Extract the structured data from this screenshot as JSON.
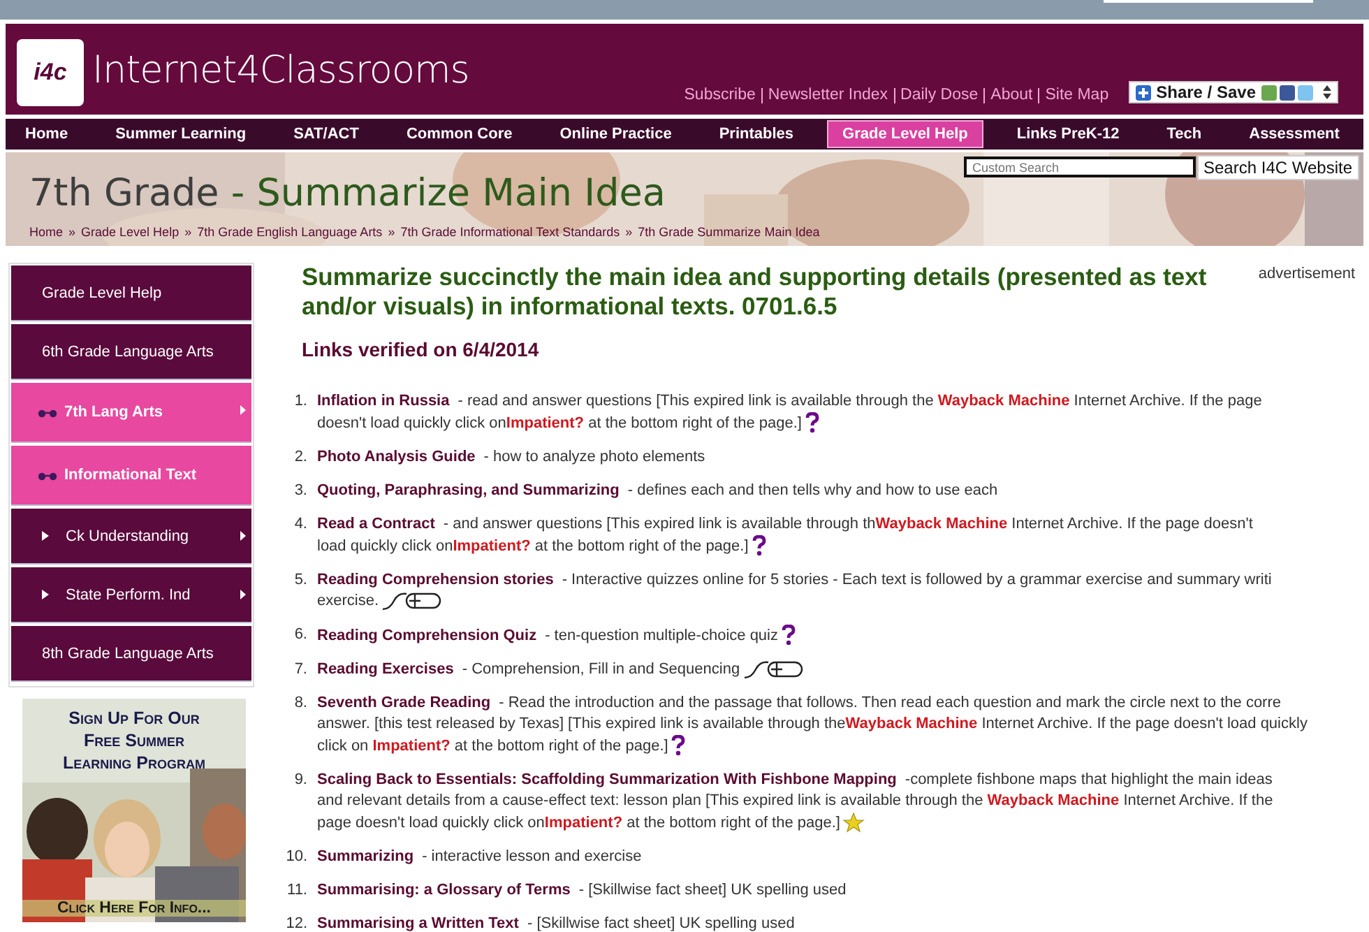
{
  "header": {
    "logo_text": "i4c",
    "site_name": "Internet4Classrooms",
    "links": [
      "Subscribe",
      "Newsletter Index",
      "Daily Dose",
      "About",
      "Site Map"
    ],
    "share_button": "Share / Save"
  },
  "nav": [
    {
      "label": "Home",
      "selected": false
    },
    {
      "label": "Summer Learning",
      "selected": false
    },
    {
      "label": "SAT/ACT",
      "selected": false
    },
    {
      "label": "Common Core",
      "selected": false
    },
    {
      "label": "Online Practice",
      "selected": false
    },
    {
      "label": "Printables",
      "selected": false
    },
    {
      "label": "Grade Level Help",
      "selected": true
    },
    {
      "label": "Links PreK-12",
      "selected": false
    },
    {
      "label": "Tech",
      "selected": false
    },
    {
      "label": "Assessment",
      "selected": false
    }
  ],
  "banner": {
    "title_grade": "7th Grade",
    "title_topic": "- Summarize Main Idea",
    "search": {
      "placeholder": "Custom Search",
      "button": "Search I4C Website"
    },
    "breadcrumb": [
      "Home",
      "Grade Level Help",
      "7th Grade English Language Arts",
      "7th Grade Informational Text Standards",
      "7th Grade Summarize Main Idea"
    ],
    "breadcrumb_separator": "»"
  },
  "sidebar": {
    "items": [
      {
        "label": "Grade Level Help",
        "selected": false,
        "arrow": false
      },
      {
        "label": "6th Grade Language Arts",
        "selected": false,
        "arrow": false
      },
      {
        "label": "7th Lang Arts",
        "selected": true,
        "arrow": true,
        "kind": "glasses"
      },
      {
        "label": "Informational Text",
        "selected": true,
        "arrow": false,
        "kind": "glasses"
      },
      {
        "label": "Ck Understanding",
        "selected": false,
        "arrow": true,
        "kind": "bullet"
      },
      {
        "label": "State Perform. Ind",
        "selected": false,
        "arrow": true,
        "kind": "bullet"
      },
      {
        "label": "8th Grade Language Arts",
        "selected": false,
        "arrow": false
      }
    ],
    "ad": {
      "headline": [
        "Sign Up For Our",
        "Free Summer",
        "Learning Program"
      ],
      "cta": "Click Here For Info..."
    }
  },
  "content": {
    "heading": "Summarize succinctly the main idea and supporting details (presented as text and/or visuals) in informational texts. 0701.6.5",
    "advertisement": "advertisement",
    "verified": "Links verified on 6/4/2014",
    "items": [
      {
        "number": "1.",
        "title": "Inflation in Russia",
        "lines": [
          "- read and answer questions [This expired link is available through the **Wayback Machine** Internet Archive. If the page",
          "doesn't load quickly click on**Impatient?** at the bottom right of the page.]"
        ],
        "kind": "question"
      },
      {
        "number": "2.",
        "title": "Photo Analysis Guide",
        "lines": [
          "- how to analyze photo elements"
        ]
      },
      {
        "number": "3.",
        "title": "Quoting, Paraphrasing, and Summarizing",
        "lines": [
          "- defines each and then tells why and how to use each"
        ]
      },
      {
        "number": "4.",
        "title": "Read a Contract",
        "lines": [
          "- and answer questions [This expired link is available through th**Wayback Machine** Internet Archive. If the page doesn't",
          "load quickly click on**Impatient?** at the bottom right of the page.]"
        ],
        "kind": "question"
      },
      {
        "number": "5.",
        "title": "Reading Comprehension stories",
        "lines": [
          "- Interactive quizzes online for 5 stories - Each text is followed by a grammar exercise and summary writi",
          "exercise."
        ],
        "kind": "squiggle"
      },
      {
        "number": "6.",
        "title": "Reading Comprehension Quiz",
        "lines": [
          "- ten-question multiple-choice quiz"
        ],
        "kind": "question"
      },
      {
        "number": "7.",
        "title": "Reading Exercises",
        "lines": [
          "- Comprehension, Fill in and Sequencing"
        ],
        "kind": "squiggle"
      },
      {
        "number": "8.",
        "title": "Seventh Grade Reading",
        "lines": [
          "- Read the introduction and the passage that follows. Then read each question and mark the circle next to the corre",
          "answer. [this test released by Texas] [This expired link is available through the**Wayback Machine** Internet Archive. If the page doesn't load quickly",
          "click on **Impatient?** at the bottom right of the page.]"
        ],
        "kind": "question"
      },
      {
        "number": "9.",
        "title": "Scaling Back to Essentials: Scaffolding Summarization With Fishbone Mapping",
        "lines": [
          "-complete fishbone maps that highlight the main ideas",
          "and relevant details from a cause-effect text: lesson plan [This expired link is available through the **Wayback Machine** Internet Archive. If the",
          "page doesn't load quickly click on**Impatient?** at the bottom right of the page.]"
        ],
        "kind": "star"
      },
      {
        "number": "10.",
        "title": "Summarizing",
        "lines": [
          "- interactive lesson and exercise"
        ]
      },
      {
        "number": "11.",
        "title": "Summarising: a Glossary of Terms",
        "lines": [
          "- [Skillwise fact sheet] UK spelling used"
        ]
      },
      {
        "number": "12.",
        "title": "Summarising a Written Text",
        "lines": [
          "- [Skillwise fact sheet] UK spelling used"
        ]
      }
    ]
  }
}
